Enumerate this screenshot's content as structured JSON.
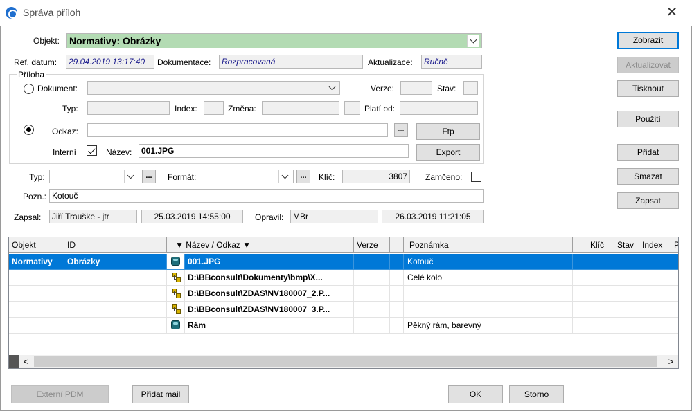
{
  "window": {
    "title": "Správa příloh",
    "close": "✕"
  },
  "form": {
    "objekt_label": "Objekt:",
    "objekt_value": "Normativy: Obrázky",
    "ref_datum_label": "Ref. datum:",
    "ref_datum_value": "29.04.2019 13:17:40",
    "dokumentace_label": "Dokumentace:",
    "dokumentace_value": "Rozpracovaná",
    "aktualizace_label": "Aktualizace:",
    "aktualizace_value": "Ručně",
    "priloha_label": "Příloha",
    "dokument_label": "Dokument:",
    "dokument_value": "",
    "verze_label": "Verze:",
    "verze_value": "",
    "stav_label": "Stav:",
    "stav_value": "",
    "typ_label": "Typ:",
    "typ_value": "",
    "index_label": "Index:",
    "index_value": "",
    "zmena_label": "Změna:",
    "zmena_value": "",
    "plati_od_label": "Platí od:",
    "plati_od_value": "",
    "odkaz_label": "Odkaz:",
    "odkaz_value": "",
    "dots": "...",
    "ftp_label": "Ftp",
    "interni_label": "Interní",
    "nazev_label": "Název:",
    "nazev_value": "001.JPG",
    "export_label": "Export",
    "typ2_label": "Typ:",
    "typ2_value": "",
    "format_label": "Formát:",
    "format_value": "",
    "klic_label": "Klíč:",
    "klic_value": "3807",
    "zamceno_label": "Zamčeno:",
    "pozn_label": "Pozn.:",
    "pozn_value": "Kotouč",
    "zapsal_label": "Zapsal:",
    "zapsal_value": "Jiří Trauške - jtr",
    "zapsal_date": "25.03.2019 14:55:00",
    "opravil_label": "Opravil:",
    "opravil_value": "MBr",
    "opravil_date": "26.03.2019 11:21:05"
  },
  "side_buttons": {
    "zobrazit": "Zobrazit",
    "aktualizovat": "Aktualizovat",
    "tisknout": "Tisknout",
    "pouziti": "Použití",
    "pridat": "Přidat",
    "smazat": "Smazat",
    "zapsat": "Zapsat"
  },
  "grid": {
    "columns": [
      "Objekt",
      "ID",
      "▼ Název / Odkaz ▼",
      "Verze",
      "",
      "Poznámka",
      "Klíč",
      "Stav",
      "Index",
      "P"
    ],
    "rows": [
      {
        "objekt": "Normativy",
        "id": "Obrázky",
        "icon": "database-icon",
        "nazev": "001.JPG",
        "verze": "",
        "poznamka": "Kotouč",
        "selected": true
      },
      {
        "objekt": "",
        "id": "",
        "icon": "tree-link-icon",
        "nazev": "D:\\BBconsult\\Dokumenty\\bmp\\X...",
        "verze": "",
        "poznamka": "Celé kolo",
        "selected": false
      },
      {
        "objekt": "",
        "id": "",
        "icon": "tree-link-icon",
        "nazev": "D:\\BBconsult\\ZDAS\\NV180007_2.P...",
        "verze": "",
        "poznamka": "",
        "selected": false
      },
      {
        "objekt": "",
        "id": "",
        "icon": "tree-link-icon",
        "nazev": "D:\\BBconsult\\ZDAS\\NV180007_3.P...",
        "verze": "",
        "poznamka": "",
        "selected": false
      },
      {
        "objekt": "",
        "id": "",
        "icon": "database-icon",
        "nazev": "Rám",
        "verze": "",
        "poznamka": "Pěkný rám, barevný",
        "selected": false
      }
    ],
    "scroll_left": "<",
    "scroll_right": ">"
  },
  "bottom_buttons": {
    "externi_pdm": "Externí PDM",
    "pridat_mail": "Přidat mail",
    "ok": "OK",
    "storno": "Storno"
  },
  "colors": {
    "accent": "#0078d7",
    "objekt_bg": "#b3dbb3",
    "selection": "#0078d7"
  }
}
